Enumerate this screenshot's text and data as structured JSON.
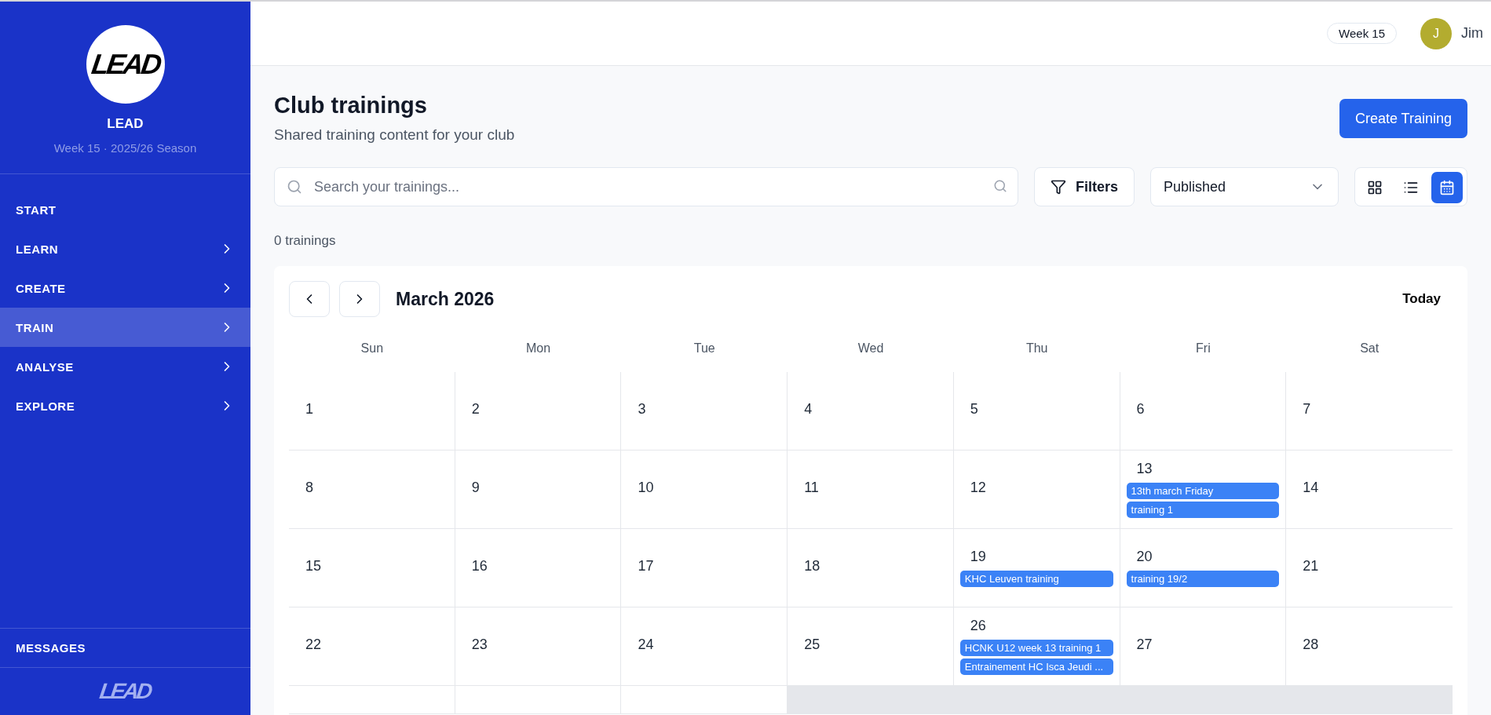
{
  "sidebar": {
    "logo": "LEAD",
    "club_name": "LEAD",
    "season": "Week 15 · 2025/26 Season",
    "items": [
      {
        "label": "START",
        "expandable": false,
        "selected": false
      },
      {
        "label": "LEARN",
        "expandable": true,
        "selected": false
      },
      {
        "label": "CREATE",
        "expandable": true,
        "selected": false
      },
      {
        "label": "TRAIN",
        "expandable": true,
        "selected": true
      },
      {
        "label": "ANALYSE",
        "expandable": true,
        "selected": false
      },
      {
        "label": "EXPLORE",
        "expandable": true,
        "selected": false
      }
    ],
    "footer_item": "MESSAGES",
    "footer_logo": "LEAD"
  },
  "header": {
    "week_badge": "Week 15",
    "user": {
      "initial": "J",
      "name": "Jim"
    }
  },
  "page": {
    "title": "Club trainings",
    "subtitle": "Shared training content for your club",
    "create_button": "Create Training",
    "search": {
      "placeholder": "Search your trainings..."
    },
    "filters_button": "Filters",
    "status_select": "Published",
    "views": [
      {
        "kind": "grid",
        "selected": false
      },
      {
        "kind": "list",
        "selected": false
      },
      {
        "kind": "calendar",
        "selected": true
      }
    ],
    "count": "0 trainings"
  },
  "calendar": {
    "month": "March 2026",
    "today_button": "Today",
    "weekdays": [
      "Sun",
      "Mon",
      "Tue",
      "Wed",
      "Thu",
      "Fri",
      "Sat"
    ],
    "weeks": [
      [
        {
          "day": "1",
          "outside": false
        },
        {
          "day": "2",
          "outside": false
        },
        {
          "day": "3",
          "outside": false
        },
        {
          "day": "4",
          "outside": false
        },
        {
          "day": "5",
          "outside": false
        },
        {
          "day": "6",
          "outside": false
        },
        {
          "day": "7",
          "outside": false
        }
      ],
      [
        {
          "day": "8",
          "outside": false
        },
        {
          "day": "9",
          "outside": false
        },
        {
          "day": "10",
          "outside": false
        },
        {
          "day": "11",
          "outside": false
        },
        {
          "day": "12",
          "outside": false
        },
        {
          "day": "13",
          "outside": false,
          "events": [
            "13th march Friday",
            "training 1"
          ]
        },
        {
          "day": "14",
          "outside": false
        }
      ],
      [
        {
          "day": "15",
          "outside": false
        },
        {
          "day": "16",
          "outside": false
        },
        {
          "day": "17",
          "outside": false
        },
        {
          "day": "18",
          "outside": false
        },
        {
          "day": "19",
          "outside": false,
          "events": [
            "KHC Leuven training"
          ]
        },
        {
          "day": "20",
          "outside": false,
          "events": [
            "training 19/2"
          ]
        },
        {
          "day": "21",
          "outside": false
        }
      ],
      [
        {
          "day": "22",
          "outside": false
        },
        {
          "day": "23",
          "outside": false
        },
        {
          "day": "24",
          "outside": false
        },
        {
          "day": "25",
          "outside": false
        },
        {
          "day": "26",
          "outside": false,
          "events": [
            "HCNK U12 week 13 training 1",
            "Entrainement HC Isca Jeudi ..."
          ]
        },
        {
          "day": "27",
          "outside": false
        },
        {
          "day": "28",
          "outside": false
        }
      ],
      [
        {
          "outside": false
        },
        {
          "outside": false
        },
        {
          "outside": false
        },
        {
          "outside": true
        },
        {
          "outside": true
        },
        {
          "outside": true
        },
        {
          "outside": true
        }
      ]
    ]
  }
}
